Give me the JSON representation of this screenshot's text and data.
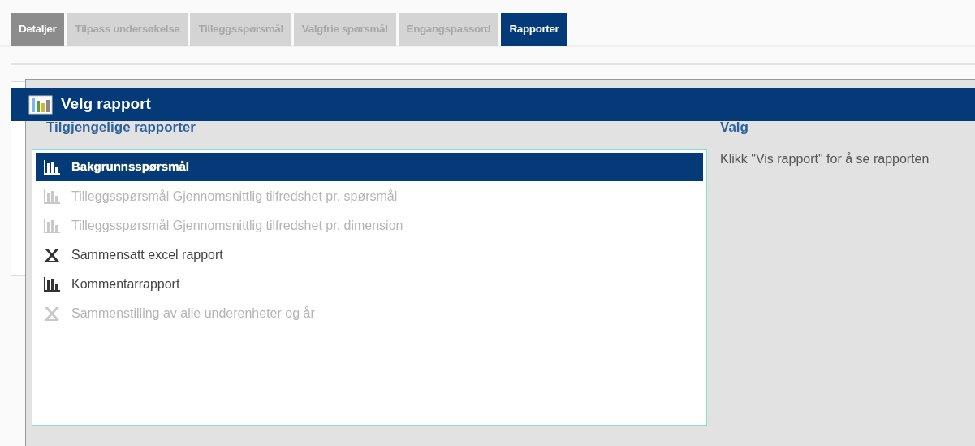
{
  "tabs": [
    {
      "label": "Detaljer",
      "selected": false,
      "kind": "visited"
    },
    {
      "label": "Tilpass undersøkelse",
      "selected": false,
      "kind": "plain"
    },
    {
      "label": "Tilleggsspørsmål",
      "selected": false,
      "kind": "plain"
    },
    {
      "label": "Valgfrie spørsmål",
      "selected": false,
      "kind": "plain"
    },
    {
      "label": "Engangspassord",
      "selected": false,
      "kind": "plain"
    },
    {
      "label": "Rapporter",
      "selected": true,
      "kind": "plain"
    }
  ],
  "dialog": {
    "title": "Velg rapport",
    "left_heading": "Tilgjengelige rapporter",
    "right_heading": "Valg",
    "reports": [
      {
        "label": "Bakgrunnsspørsmål",
        "kind": "chart",
        "selected": true,
        "disabled": false
      },
      {
        "label": "Tilleggsspørsmål Gjennomsnittlig tilfredshet pr. spørsmål",
        "kind": "chart",
        "selected": false,
        "disabled": true
      },
      {
        "label": "Tilleggsspørsmål Gjennomsnittlig tilfredshet pr. dimension",
        "kind": "chart",
        "selected": false,
        "disabled": true
      },
      {
        "label": "Sammensatt excel rapport",
        "kind": "excel",
        "selected": false,
        "disabled": false
      },
      {
        "label": "Kommentarrapport",
        "kind": "chart",
        "selected": false,
        "disabled": false
      },
      {
        "label": "Sammenstilling av alle underenheter og år",
        "kind": "excel",
        "selected": false,
        "disabled": true
      }
    ],
    "hint": "Klikk \"Vis rapport\" for å se rapporten"
  }
}
